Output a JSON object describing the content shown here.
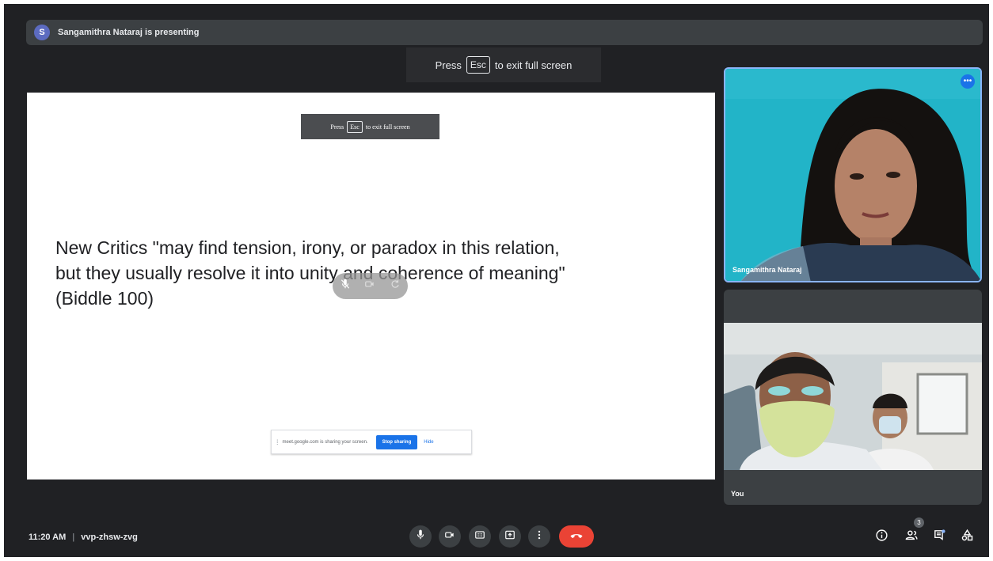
{
  "presenter_banner": {
    "avatar_initial": "S",
    "text": "Sangamithra Nataraj is presenting"
  },
  "esc_banner": {
    "prefix": "Press",
    "key": "Esc",
    "suffix": "to exit full screen"
  },
  "slide": {
    "inner_esc": {
      "prefix": "Press",
      "key": "Esc",
      "suffix": "to exit full screen"
    },
    "quote_lines": [
      "New Critics \"may find tension, irony, or paradox in this relation,",
      "but they usually resolve it into unity and coherence of meaning\"",
      "(Biddle 100)"
    ],
    "share_bar": {
      "grip": "⁞",
      "message": "meet.google.com is sharing your screen.",
      "stop_label": "Stop sharing",
      "hide_label": "Hide"
    }
  },
  "participants": [
    {
      "name": "Sangamithra Nataraj",
      "more_icon": "more-horizontal-icon"
    },
    {
      "name": "You"
    }
  ],
  "bottom_bar": {
    "time": "11:20 AM",
    "separator": "|",
    "meeting_code": "vvp-zhsw-zvg",
    "controls": [
      "microphone-icon",
      "camera-icon",
      "captions-icon",
      "present-icon",
      "more-vertical-icon",
      "hang-up-icon"
    ],
    "right_icons": [
      "info-icon",
      "people-icon",
      "chat-icon",
      "activities-icon"
    ],
    "people_count": "3"
  },
  "colors": {
    "background": "#202124",
    "surface": "#3c4043",
    "accent": "#1a73e8",
    "hangup": "#ea4335",
    "active_border": "#8ab4f8"
  }
}
